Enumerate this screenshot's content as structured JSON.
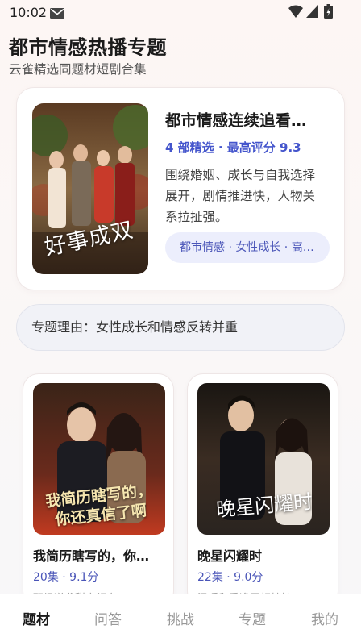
{
  "status_bar": {
    "time": "10:02",
    "icons": [
      "mail-icon",
      "wifi-icon",
      "signal-icon",
      "battery-icon"
    ]
  },
  "header": {
    "title": "都市情感热播专题",
    "subtitle": "云雀精选同题材短剧合集"
  },
  "feature": {
    "poster_title": "好事成双",
    "title": "都市情感连续追看…",
    "meta": "4 部精选 · 最高评分 9.3",
    "description": "围绕婚姻、成长与自我选择展开，剧情推进快，人物关系拉扯强。",
    "tags": "都市情感 · 女性成长 · 高…"
  },
  "reason": "专题理由：女性成长和情感反转并重",
  "dramas": [
    {
      "poster_title": "我简历瞎写的，你还真信了啊",
      "title": "我简历瞎写的，你…",
      "meta": "20集 · 9.1分",
      "description": "职场逆袭甜宠都市"
    },
    {
      "poster_title": "晚星闪耀时",
      "title": "晚星闪耀时",
      "meta": "22集 · 9.0分",
      "description": "温暖和重逢互相扶持"
    }
  ],
  "nav": {
    "items": [
      "题材",
      "问答",
      "挑战",
      "专题",
      "我的"
    ],
    "active": "题材"
  },
  "colors": {
    "accent": "#4455cc",
    "tag_bg": "#eceefc",
    "background": "#fbf7f6"
  }
}
